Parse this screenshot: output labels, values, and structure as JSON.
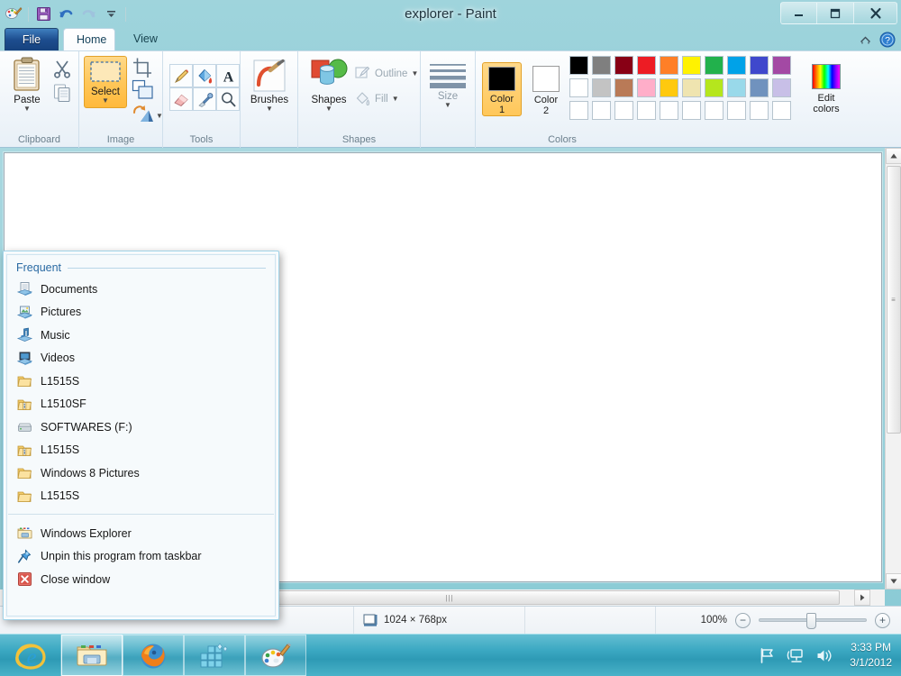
{
  "window": {
    "title": "explorer - Paint",
    "minimize_label": "Minimize",
    "maximize_label": "Restore",
    "close_label": "Close"
  },
  "quick_access": {
    "app_icon": "paint-app-icon",
    "save_label": "Save",
    "undo_label": "Undo",
    "redo_label": "Redo",
    "customize_label": "Customize Quick Access Toolbar"
  },
  "ribbon": {
    "tabs": [
      {
        "id": "file",
        "label": "File"
      },
      {
        "id": "home",
        "label": "Home"
      },
      {
        "id": "view",
        "label": "View"
      }
    ],
    "active_tab": "Home",
    "minimize_ribbon_label": "Minimize the Ribbon",
    "help_label": "Help",
    "groups": [
      {
        "id": "clipboard",
        "label": "Clipboard",
        "paste_label": "Paste",
        "cut_label": "Cut",
        "copy_label": "Copy"
      },
      {
        "id": "image",
        "label": "Image",
        "select_label": "Select",
        "crop_label": "Crop",
        "resize_label": "Resize",
        "rotate_label": "Rotate"
      },
      {
        "id": "tools",
        "label": "Tools",
        "items": [
          "Pencil",
          "Fill with color",
          "Text",
          "Eraser",
          "Color picker",
          "Magnifier"
        ]
      },
      {
        "id": "brushes",
        "label": "Brushes",
        "brushes_label": "Brushes"
      },
      {
        "id": "shapes",
        "label": "Shapes",
        "shapes_label": "Shapes",
        "outline_label": "Outline",
        "fill_label": "Fill"
      },
      {
        "id": "size",
        "label": "Size",
        "size_label": "Size"
      },
      {
        "id": "colors",
        "label": "Colors",
        "color1_label": "Color\n1",
        "color1_line1": "Color",
        "color1_line2": "1",
        "color2_line1": "Color",
        "color2_line2": "2",
        "edit_colors_line1": "Edit",
        "edit_colors_line2": "colors",
        "color1_value": "#000000",
        "color2_value": "#ffffff",
        "palette_row1": [
          "#000000",
          "#7f7f7f",
          "#880015",
          "#ed1c24",
          "#ff7f27",
          "#fff200",
          "#22b14c",
          "#00a2e8",
          "#3f48cc",
          "#a349a4"
        ],
        "palette_row2": [
          "#ffffff",
          "#c3c3c3",
          "#b97a57",
          "#ffaec9",
          "#ffc90e",
          "#efe4b0",
          "#b5e61d",
          "#99d9ea",
          "#7092be",
          "#c8bfe7"
        ],
        "palette_row3": [
          "",
          "",
          "",
          "",
          "",
          "",
          "",
          "",
          "",
          ""
        ]
      }
    ]
  },
  "canvas": {
    "vertical_scrollbar": {
      "up_arrow": "▲",
      "down_arrow": "▼",
      "grip": "≡"
    },
    "horizontal_scrollbar": {
      "right_arrow": "▶",
      "grip": "|||"
    }
  },
  "statusbar": {
    "dimensions_icon": "canvas-size-icon",
    "dimensions": "1024 × 768px",
    "zoom_level": "100%",
    "zoom_out_label": "−",
    "zoom_in_label": "+"
  },
  "jumplist": {
    "section_title": "Frequent",
    "frequent_items": [
      {
        "label": "Documents",
        "icon": "documents-library-icon"
      },
      {
        "label": "Pictures",
        "icon": "pictures-library-icon"
      },
      {
        "label": "Music",
        "icon": "music-library-icon"
      },
      {
        "label": "Videos",
        "icon": "videos-library-icon"
      },
      {
        "label": "L1515S",
        "icon": "folder-icon"
      },
      {
        "label": "L1510SF",
        "icon": "folder-info-icon"
      },
      {
        "label": "SOFTWARES (F:)",
        "icon": "drive-icon"
      },
      {
        "label": "L1515S",
        "icon": "folder-info-icon"
      },
      {
        "label": "Windows 8 Pictures",
        "icon": "folder-icon"
      },
      {
        "label": "L1515S",
        "icon": "folder-icon"
      }
    ],
    "task_items": [
      {
        "label": "Windows Explorer",
        "icon": "explorer-icon"
      },
      {
        "label": "Unpin this program from taskbar",
        "icon": "pin-icon"
      },
      {
        "label": "Close window",
        "icon": "close-window-icon"
      }
    ]
  },
  "taskbar": {
    "items": [
      {
        "id": "ie",
        "label": "Internet Explorer",
        "state": "pinned"
      },
      {
        "id": "explorer",
        "label": "Windows Explorer",
        "state": "pinned-active"
      },
      {
        "id": "firefox",
        "label": "Mozilla Firefox",
        "state": "running"
      },
      {
        "id": "app4",
        "label": "Application",
        "state": "running"
      },
      {
        "id": "paint",
        "label": "Paint",
        "state": "running"
      }
    ],
    "tray": [
      {
        "id": "action-center",
        "icon": "flag-icon",
        "label": "Action Center"
      },
      {
        "id": "network",
        "icon": "network-icon",
        "label": "Network"
      },
      {
        "id": "volume",
        "icon": "speaker-icon",
        "label": "Volume"
      }
    ],
    "clock_time": "3:33 PM",
    "clock_date": "3/1/2012"
  },
  "theme": {
    "accent": "#3ba8c2",
    "title_bar": "#8cccd6",
    "ribbon_highlight": "#ffc75a",
    "jumplist_border": "#9fd2e8",
    "file_tab": "#1d4e8f"
  }
}
